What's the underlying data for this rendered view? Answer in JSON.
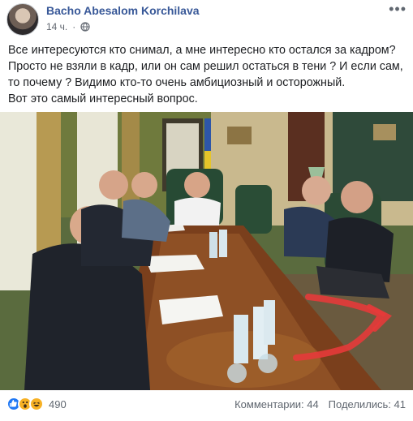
{
  "post": {
    "author": "Bacho Abesalom Korchilava",
    "time": "14 ч.",
    "privacy_icon": "globe-icon",
    "text_lines": [
      "Все интересуются кто снимал, а мне интересно кто остался за кадром?",
      "Просто не взяли в кадр, или он сам решил остаться в тени ? И если сам,",
      "то почему ? Видимо кто-то очень амбициозный и осторожный.",
      "Вот это самый интересный вопрос."
    ]
  },
  "reactions": {
    "icons": [
      "like-icon",
      "wow-icon",
      "haha-icon"
    ],
    "count": "490",
    "comments": "Комментарии: 44",
    "shares": "Поделились: 41"
  },
  "colors": {
    "author": "#385898",
    "secondary_text": "#616770",
    "like": "#2078f4",
    "emoji": "#f7b125"
  }
}
